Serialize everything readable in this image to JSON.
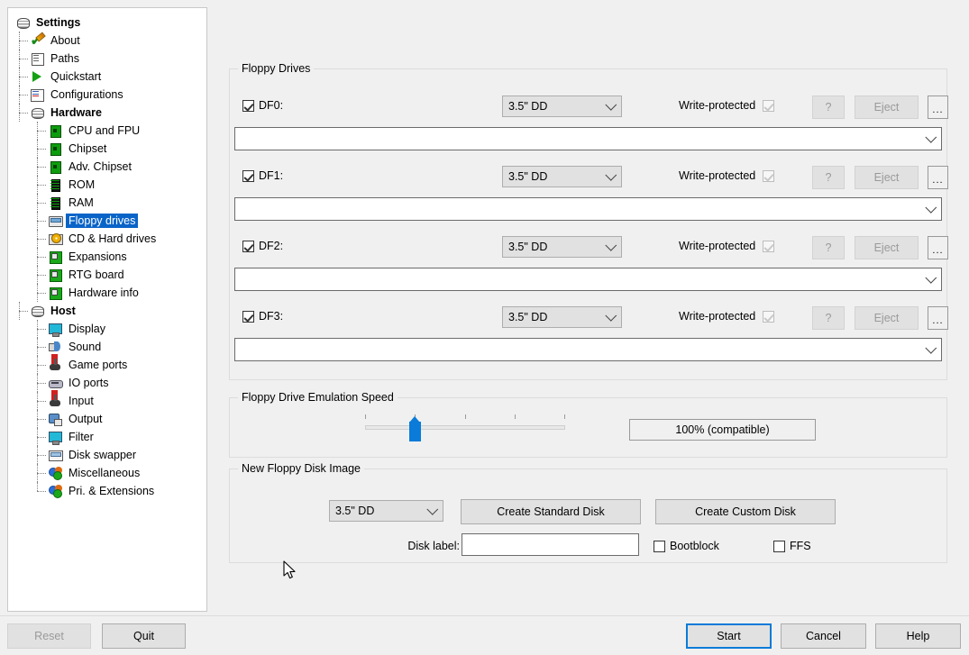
{
  "window": {
    "background": "#f0f0f0",
    "accent": "#0a7bd8",
    "selection": "#0a64c8"
  },
  "sidebar": {
    "items": [
      {
        "label": "Settings",
        "icon": "disc-stack-icon",
        "depth": 0,
        "bold": true,
        "selected": false
      },
      {
        "label": "About",
        "icon": "about-pencil-icon",
        "depth": 1,
        "bold": false,
        "selected": false
      },
      {
        "label": "Paths",
        "icon": "paths-page-icon",
        "depth": 1,
        "bold": false,
        "selected": false
      },
      {
        "label": "Quickstart",
        "icon": "play-icon",
        "depth": 1,
        "bold": false,
        "selected": false
      },
      {
        "label": "Configurations",
        "icon": "configurations-icon",
        "depth": 1,
        "bold": false,
        "selected": false
      },
      {
        "label": "Hardware",
        "icon": "disc-stack-icon",
        "depth": 1,
        "bold": true,
        "selected": false
      },
      {
        "label": "CPU and FPU",
        "icon": "chip-icon",
        "depth": 2,
        "bold": false,
        "selected": false
      },
      {
        "label": "Chipset",
        "icon": "chip-icon",
        "depth": 2,
        "bold": false,
        "selected": false
      },
      {
        "label": "Adv. Chipset",
        "icon": "chip-icon",
        "depth": 2,
        "bold": false,
        "selected": false
      },
      {
        "label": "ROM",
        "icon": "memory-chip-icon",
        "depth": 2,
        "bold": false,
        "selected": false
      },
      {
        "label": "RAM",
        "icon": "memory-chip-icon",
        "depth": 2,
        "bold": false,
        "selected": false
      },
      {
        "label": "Floppy drives",
        "icon": "floppy-drive-icon",
        "depth": 2,
        "bold": false,
        "selected": true
      },
      {
        "label": "CD & Hard drives",
        "icon": "cd-drive-icon",
        "depth": 2,
        "bold": false,
        "selected": false
      },
      {
        "label": "Expansions",
        "icon": "board-icon",
        "depth": 2,
        "bold": false,
        "selected": false
      },
      {
        "label": "RTG board",
        "icon": "board-icon",
        "depth": 2,
        "bold": false,
        "selected": false
      },
      {
        "label": "Hardware info",
        "icon": "board-icon",
        "depth": 2,
        "bold": false,
        "selected": false
      },
      {
        "label": "Host",
        "icon": "disc-stack-icon",
        "depth": 1,
        "bold": true,
        "selected": false
      },
      {
        "label": "Display",
        "icon": "monitor-icon",
        "depth": 2,
        "bold": false,
        "selected": false
      },
      {
        "label": "Sound",
        "icon": "sound-icon",
        "depth": 2,
        "bold": false,
        "selected": false
      },
      {
        "label": "Game ports",
        "icon": "joystick-icon",
        "depth": 2,
        "bold": false,
        "selected": false
      },
      {
        "label": "IO ports",
        "icon": "io-ports-icon",
        "depth": 2,
        "bold": false,
        "selected": false
      },
      {
        "label": "Input",
        "icon": "joystick-icon",
        "depth": 2,
        "bold": false,
        "selected": false
      },
      {
        "label": "Output",
        "icon": "output-icon",
        "depth": 2,
        "bold": false,
        "selected": false
      },
      {
        "label": "Filter",
        "icon": "monitor-icon",
        "depth": 2,
        "bold": false,
        "selected": false
      },
      {
        "label": "Disk swapper",
        "icon": "disk-swapper-icon",
        "depth": 2,
        "bold": false,
        "selected": false
      },
      {
        "label": "Miscellaneous",
        "icon": "misc-icon",
        "depth": 2,
        "bold": false,
        "selected": false
      },
      {
        "label": "Pri. & Extensions",
        "icon": "misc-icon",
        "depth": 2,
        "bold": false,
        "selected": false
      }
    ]
  },
  "floppy_drives": {
    "group_title": "Floppy Drives",
    "write_protected_label": "Write-protected",
    "help_button_label": "?",
    "eject_button_label": "Eject",
    "browse_button_label": "...",
    "drives": [
      {
        "name": "DF0:",
        "enabled": true,
        "type": "3.5\" DD",
        "path": "",
        "write_protected": true,
        "write_protected_disabled": true,
        "eject_disabled": true,
        "help_disabled": true
      },
      {
        "name": "DF1:",
        "enabled": true,
        "type": "3.5\" DD",
        "path": "",
        "write_protected": true,
        "write_protected_disabled": true,
        "eject_disabled": true,
        "help_disabled": true
      },
      {
        "name": "DF2:",
        "enabled": true,
        "type": "3.5\" DD",
        "path": "",
        "write_protected": true,
        "write_protected_disabled": true,
        "eject_disabled": true,
        "help_disabled": true
      },
      {
        "name": "DF3:",
        "enabled": true,
        "type": "3.5\" DD",
        "path": "",
        "write_protected": true,
        "write_protected_disabled": true,
        "eject_disabled": true,
        "help_disabled": true
      }
    ]
  },
  "emulation_speed": {
    "group_title": "Floppy Drive Emulation Speed",
    "value_label": "100% (compatible)",
    "tick_count": 5,
    "thumb_index": 1
  },
  "new_disk_image": {
    "group_title": "New Floppy Disk Image",
    "type": "3.5\" DD",
    "create_standard_label": "Create Standard Disk",
    "create_custom_label": "Create Custom Disk",
    "disk_label_caption": "Disk label:",
    "disk_label_value": "",
    "bootblock_label": "Bootblock",
    "bootblock_checked": false,
    "ffs_label": "FFS",
    "ffs_checked": false
  },
  "footer": {
    "reset_label": "Reset",
    "reset_disabled": true,
    "quit_label": "Quit",
    "start_label": "Start",
    "cancel_label": "Cancel",
    "help_label": "Help"
  }
}
